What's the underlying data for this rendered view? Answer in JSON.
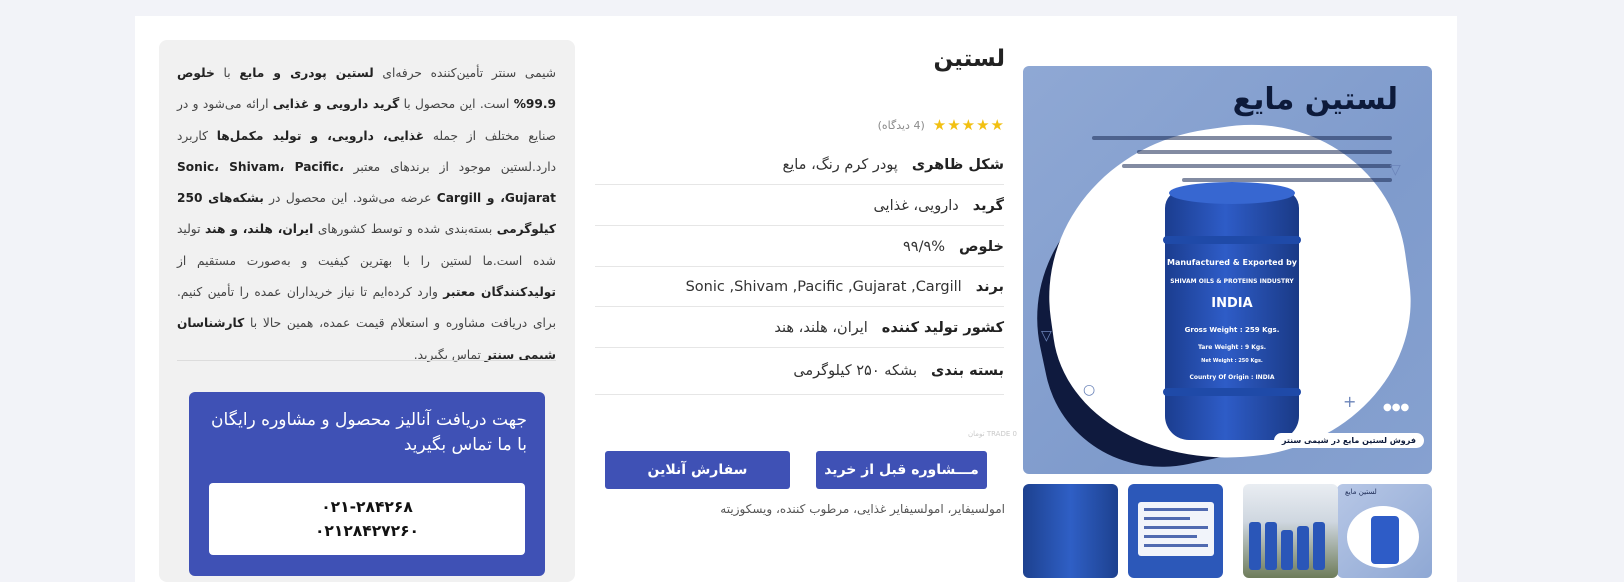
{
  "product": {
    "title": "لستین",
    "stars": "★★★★★",
    "views": "(4 دیدگاه)",
    "attributes": [
      {
        "key": "شکل ظاهری",
        "value": "پودر کرم رنگ، مایع"
      },
      {
        "key": "گرید",
        "value": "دارویی، غذایی"
      },
      {
        "key": "خلوص",
        "value": "۹۹/۹%"
      },
      {
        "key": "برند",
        "value": "Sonic ,Shivam ,Pacific ,Gujarat ,Cargill"
      },
      {
        "key": "کشور تولید کننده",
        "value": "ایران، هلند، هند"
      },
      {
        "key": "بسته بندی",
        "value": "بشکه ۲۵۰ کیلوگرمی"
      }
    ],
    "small_note": "0 TRADE تومان",
    "buttons": {
      "consult": "مـــشاوره قبل از خرید",
      "order": "سفارش آنلاین"
    },
    "tags": "امولسیفایر، امولسیفایر غذایی، مرطوب کننده، ویسکوزیته"
  },
  "image": {
    "title": "لستین مایع",
    "barrel_line1": "Manufactured & Exported by",
    "barrel_line2": "SHIVAM OILS & PROTEINS INDUSTRY",
    "barrel_country": "INDIA",
    "barrel_gross": "Gross Weight  :  259 Kgs.",
    "barrel_tare": "Tare Weight  :  9 Kgs.",
    "barrel_net": "Net Weight  :  250 Kgs.",
    "barrel_origin": "Country Of Origin  :  INDIA",
    "caption": "فروش لستین مایع در شیمی سنتر",
    "thumb1_label": "لستین مایع"
  },
  "description": {
    "p1_a": "شیمی سنتر تأمین‌کننده حرفه‌ای ",
    "p1_b": "لستین پودری و مایع",
    "p1_c": " با ",
    "p1_d": "خلوص 99.9%",
    "p1_e": " است. این محصول با ",
    "p1_f": "گرید دارویی و غذایی",
    "p1_g": " ارائه می‌شود و در صنایع مختلف از جمله ",
    "p1_h": "غذایی، دارویی، و تولید مکمل‌ها",
    "p1_i": " کاربرد دارد.لستین موجود از برندهای معتبر ",
    "p1_j": "Sonic، Shivam، Pacific، Gujarat، و Cargill",
    "p1_k": " عرضه می‌شود. این محصول در ",
    "p1_l": "بشکه‌های 250 کیلوگرمی",
    "p1_m": " بسته‌بندی شده و توسط کشورهای ",
    "p1_n": "ایران، هلند، و هند",
    "p1_o": " تولید شده است.ما لستین را با بهترین کیفیت و به‌صورت مستقیم از ",
    "p1_p": "تولیدکنندگان معتبر",
    "p1_q": " وارد کرده‌ایم تا نیاز خریداران عمده را تأمین کنیم. برای دریافت مشاوره و استعلام قیمت عمده، همین حالا با ",
    "p1_r": "کارشناسان شیمی سنتر",
    "p1_s": " تماس بگیرید."
  },
  "cta": {
    "text": "جهت دریافت آنالیز محصول و مشاوره رایگان با ما تماس بگیرید",
    "phone1": "۰۲۱-۲۸۴۲۶۸",
    "phone2": "۰۲۱۲۸۴۲۷۲۶۰"
  }
}
